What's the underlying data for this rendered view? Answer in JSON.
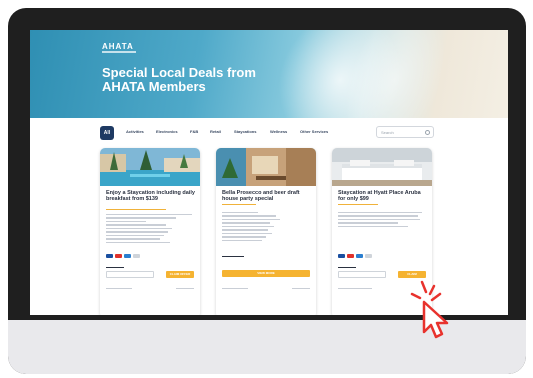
{
  "hero": {
    "brand": "AHATA",
    "title": "Special Local Deals from AHATA Members"
  },
  "filters": {
    "all": "All",
    "items": [
      "Activities",
      "Electronics",
      "F&B",
      "Retail",
      "Staycations",
      "Wellness",
      "Other Services"
    ],
    "search_placeholder": "Search"
  },
  "cards": [
    {
      "title": "Enjoy a Staycation including daily breakfast from $139",
      "button": "CLAIM OFFER"
    },
    {
      "title": "Bella Prosecco and beer draft house party special",
      "button": "VIEW MORE"
    },
    {
      "title": "Staycation at Hyatt Place Aruba for only $99",
      "button": "CLAIM"
    }
  ],
  "colors": {
    "accent": "#f5b331",
    "navy": "#1e3a63",
    "cursor": "#e8322d"
  }
}
